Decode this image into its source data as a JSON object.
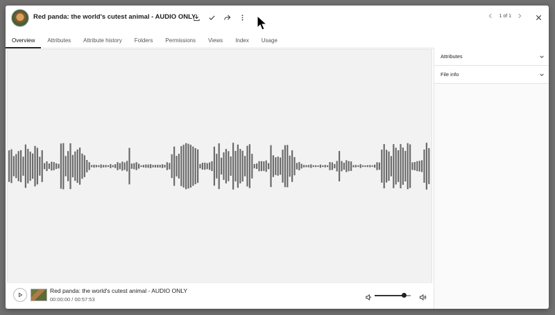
{
  "header": {
    "title": "Red panda: the world's cutest animal - AUDIO ONLY",
    "pager": "1 of 1"
  },
  "toolbar_icons": [
    "download-icon",
    "check-icon",
    "share-icon",
    "more-vert-icon"
  ],
  "tabs": [
    {
      "label": "Overview",
      "active": true
    },
    {
      "label": "Attributes"
    },
    {
      "label": "Attribute history"
    },
    {
      "label": "Folders"
    },
    {
      "label": "Permissions"
    },
    {
      "label": "Views"
    },
    {
      "label": "Index"
    },
    {
      "label": "Usage"
    }
  ],
  "player": {
    "title": "Red panda: the world's cutest animal - AUDIO ONLY",
    "time": "00:00:00 / 00:57:53",
    "volume": 0.8
  },
  "side": {
    "sections": [
      {
        "label": "Attributes"
      },
      {
        "label": "File info"
      }
    ]
  },
  "colors": {
    "waveform": "#6a6a6a",
    "viewer_bg": "#f2f2f2",
    "overlay": "#707070"
  }
}
